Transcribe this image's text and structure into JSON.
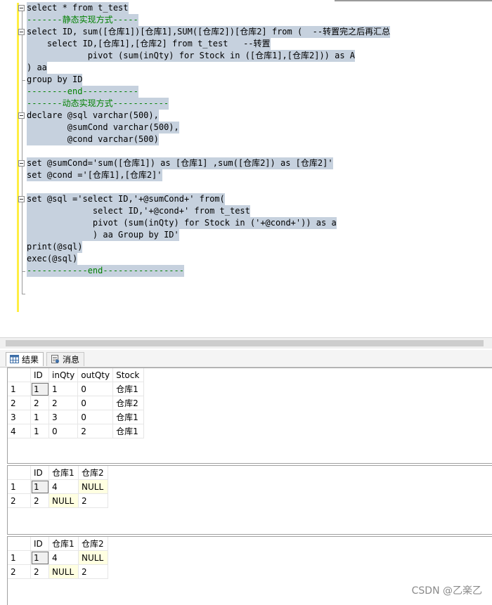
{
  "editor": {
    "lines": [
      {
        "segments": [
          {
            "t": "select * from t_test",
            "c": ""
          }
        ],
        "sel": true
      },
      {
        "segments": [
          {
            "t": "-------静态实现方式-----",
            "c": "green"
          }
        ],
        "sel": true
      },
      {
        "segments": [
          {
            "t": "select ID, sum([仓库1])[仓库1],SUM([仓库2])[仓库2] from (  --转置完之后再汇总",
            "c": ""
          }
        ],
        "sel": true
      },
      {
        "segments": [
          {
            "t": "    select ID,[仓库1],[仓库2] from t_test   --转置",
            "c": ""
          }
        ],
        "sel": true
      },
      {
        "segments": [
          {
            "t": "            pivot (sum(inQty) for Stock in ([仓库1],[仓库2])) as A",
            "c": ""
          }
        ],
        "sel": true
      },
      {
        "segments": [
          {
            "t": ") aa",
            "c": ""
          }
        ],
        "sel": true
      },
      {
        "segments": [
          {
            "t": "group by ID",
            "c": ""
          }
        ],
        "sel": true
      },
      {
        "segments": [
          {
            "t": "--------end-----------",
            "c": "green"
          }
        ],
        "sel": true
      },
      {
        "segments": [
          {
            "t": "-------动态实现方式-----------",
            "c": "green"
          }
        ],
        "sel": true
      },
      {
        "segments": [
          {
            "t": "declare @sql varchar(500),",
            "c": ""
          }
        ],
        "sel": true
      },
      {
        "segments": [
          {
            "t": "        @sumCond varchar(500),",
            "c": ""
          }
        ],
        "sel": true
      },
      {
        "segments": [
          {
            "t": "        @cond varchar(500)",
            "c": ""
          }
        ],
        "sel": true
      },
      {
        "segments": [
          {
            "t": "",
            "c": ""
          }
        ],
        "sel": false
      },
      {
        "segments": [
          {
            "t": "set @sumCond='sum([仓库1]) as [仓库1] ,sum([仓库2]) as [仓库2]'",
            "c": ""
          }
        ],
        "sel": true
      },
      {
        "segments": [
          {
            "t": "set @cond ='[仓库1],[仓库2]'",
            "c": ""
          }
        ],
        "sel": true
      },
      {
        "segments": [
          {
            "t": "",
            "c": ""
          }
        ],
        "sel": false
      },
      {
        "segments": [
          {
            "t": "set @sql ='select ID,'+@sumCond+' from(",
            "c": ""
          }
        ],
        "sel": true
      },
      {
        "segments": [
          {
            "t": "             select ID,'+@cond+' from t_test",
            "c": ""
          }
        ],
        "sel": true
      },
      {
        "segments": [
          {
            "t": "             pivot (sum(inQty) for Stock in ('+@cond+')) as a",
            "c": ""
          }
        ],
        "sel": true
      },
      {
        "segments": [
          {
            "t": "             ) aa Group by ID'",
            "c": ""
          }
        ],
        "sel": true
      },
      {
        "segments": [
          {
            "t": "print(@sql)",
            "c": ""
          }
        ],
        "sel": true
      },
      {
        "segments": [
          {
            "t": "exec(@sql)",
            "c": ""
          }
        ],
        "sel": true
      },
      {
        "segments": [
          {
            "t": "------------end----------------",
            "c": "green"
          }
        ],
        "sel": true
      }
    ]
  },
  "tabs": {
    "results_label": "结果",
    "messages_label": "消息"
  },
  "grids": [
    {
      "columns": [
        "",
        "ID",
        "inQty",
        "outQty",
        "Stock"
      ],
      "rows": [
        [
          "1",
          "1",
          "1",
          "0",
          "仓库1"
        ],
        [
          "2",
          "2",
          "2",
          "0",
          "仓库2"
        ],
        [
          "3",
          "1",
          "3",
          "0",
          "仓库1"
        ],
        [
          "4",
          "1",
          "0",
          "2",
          "仓库1"
        ]
      ]
    },
    {
      "columns": [
        "",
        "ID",
        "仓库1",
        "仓库2"
      ],
      "rows": [
        [
          "1",
          "1",
          "4",
          "NULL"
        ],
        [
          "2",
          "2",
          "NULL",
          "2"
        ]
      ]
    },
    {
      "columns": [
        "",
        "ID",
        "仓库1",
        "仓库2"
      ],
      "rows": [
        [
          "1",
          "1",
          "4",
          "NULL"
        ],
        [
          "2",
          "2",
          "NULL",
          "2"
        ]
      ]
    }
  ],
  "watermark": "CSDN @乙楽乙",
  "colors": {
    "selection": "#c6d1de",
    "margin": "#ffee44",
    "null_cell": "#ffffe1"
  }
}
